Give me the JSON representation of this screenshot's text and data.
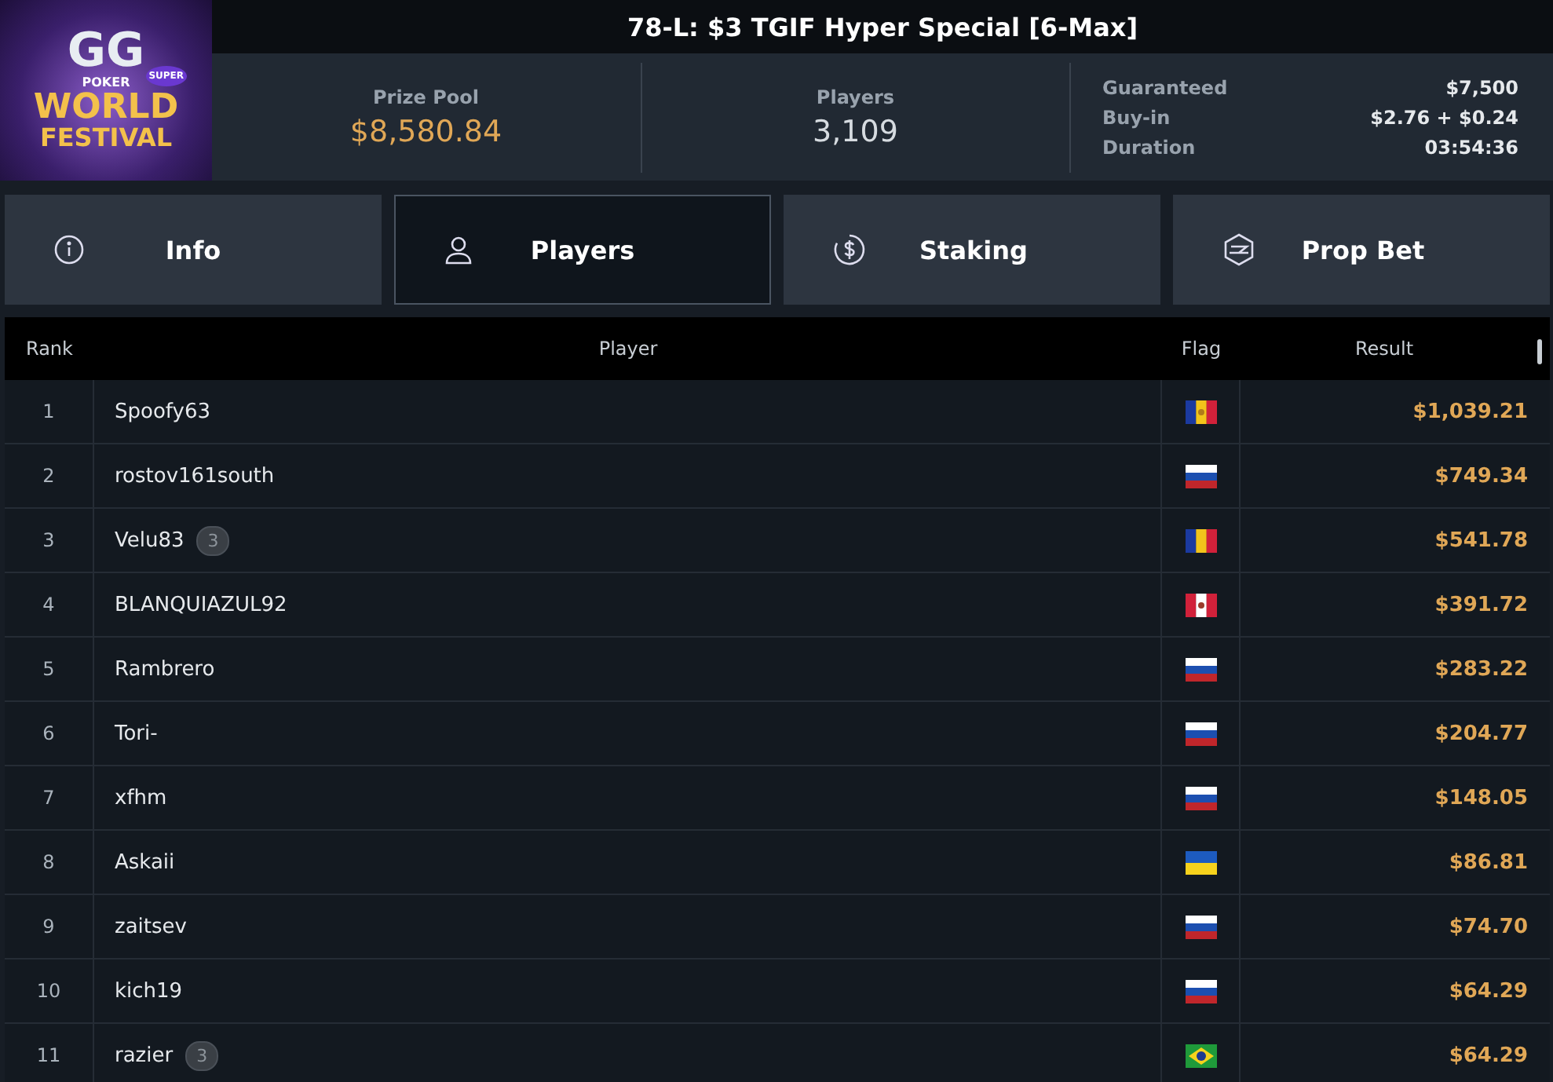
{
  "logo": {
    "brand": "GG",
    "sub": "POKER",
    "tag": "SUPER",
    "line1": "WORLD",
    "line2": "FESTIVAL"
  },
  "title": "78-L: $3 TGIF Hyper Special [6-Max]",
  "stats": {
    "prize_pool": {
      "label": "Prize Pool",
      "value": "$8,580.84"
    },
    "players": {
      "label": "Players",
      "value": "3,109"
    },
    "details": [
      {
        "label": "Guaranteed",
        "value": "$7,500"
      },
      {
        "label": "Buy-in",
        "value": "$2.76 + $0.24"
      },
      {
        "label": "Duration",
        "value": "03:54:36"
      }
    ]
  },
  "tabs": [
    {
      "kind": "info",
      "label": "Info",
      "selected": false
    },
    {
      "kind": "user",
      "label": "Players",
      "selected": true
    },
    {
      "kind": "staking",
      "label": "Staking",
      "selected": false
    },
    {
      "kind": "prop",
      "label": "Prop Bet",
      "selected": false
    }
  ],
  "table": {
    "columns": [
      "Rank",
      "Player",
      "Flag",
      "Result"
    ],
    "rows": [
      {
        "rank": "1",
        "player": "Spoofy63",
        "kind": "ad",
        "result": "$1,039.21"
      },
      {
        "rank": "2",
        "player": "rostov161south",
        "kind": "ru",
        "result": "$749.34"
      },
      {
        "rank": "3",
        "player": "Velu83",
        "badge": "3",
        "kind": "ro",
        "result": "$541.78"
      },
      {
        "rank": "4",
        "player": "BLANQUIAZUL92",
        "kind": "pe",
        "result": "$391.72"
      },
      {
        "rank": "5",
        "player": "Rambrero",
        "kind": "ru",
        "result": "$283.22"
      },
      {
        "rank": "6",
        "player": "Tori-",
        "kind": "ru",
        "result": "$204.77"
      },
      {
        "rank": "7",
        "player": "xfhm",
        "kind": "ru",
        "result": "$148.05"
      },
      {
        "rank": "8",
        "player": "Askaii",
        "kind": "ua",
        "result": "$86.81"
      },
      {
        "rank": "9",
        "player": "zaitsev",
        "kind": "ru",
        "result": "$74.70"
      },
      {
        "rank": "10",
        "player": "kich19",
        "kind": "ru",
        "result": "$64.29"
      },
      {
        "rank": "11",
        "player": "razier",
        "badge": "3",
        "kind": "br",
        "result": "$64.29"
      }
    ]
  }
}
